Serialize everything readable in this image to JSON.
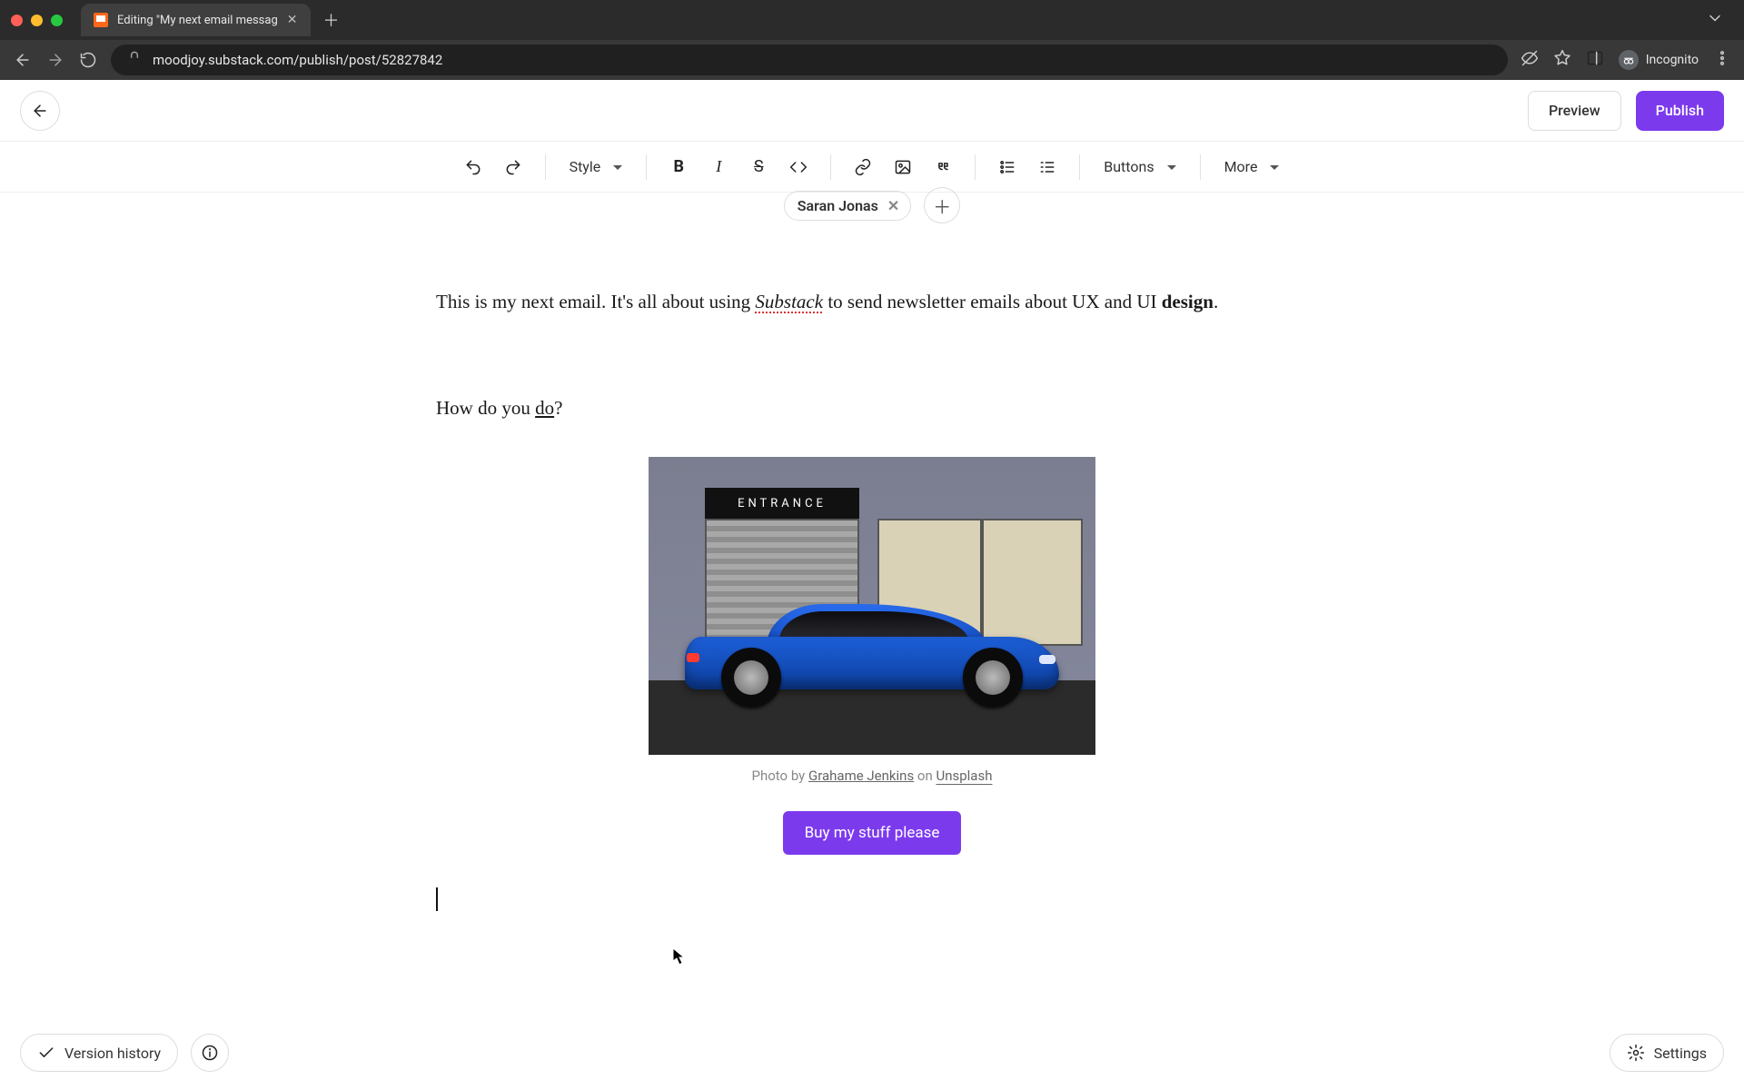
{
  "browser": {
    "tab_title": "Editing \"My next email messag",
    "url": "moodjoy.substack.com/publish/post/52827842",
    "profile_label": "Incognito"
  },
  "header": {
    "preview_label": "Preview",
    "publish_label": "Publish"
  },
  "toolbar": {
    "style_label": "Style",
    "buttons_label": "Buttons",
    "more_label": "More"
  },
  "author": {
    "chip_name": "Saran Jonas"
  },
  "content": {
    "para1_pre": "This is my next email. It's all about using ",
    "para1_substack": "Substack",
    "para1_mid": " to send newsletter emails about UX and UI ",
    "para1_bold": "design",
    "para1_post": ".",
    "para2_pre": "How do you ",
    "para2_do": "do",
    "para2_post": "?"
  },
  "image": {
    "entrance_text": "ENTRANCE",
    "caption_pre": "Photo by ",
    "caption_author": "Grahame Jenkins",
    "caption_mid": " on ",
    "caption_source": "Unsplash"
  },
  "cta": {
    "label": "Buy my stuff please"
  },
  "footer": {
    "version_history": "Version history",
    "settings": "Settings"
  }
}
